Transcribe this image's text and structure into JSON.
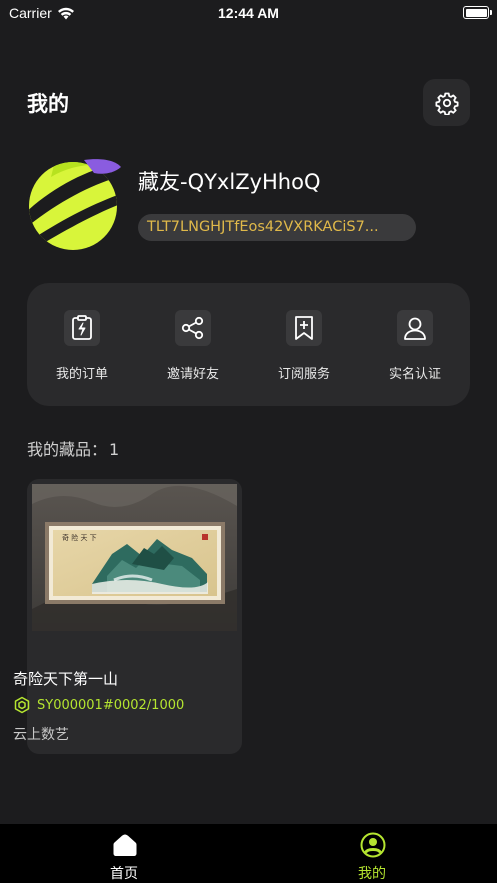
{
  "status_bar": {
    "carrier": "Carrier",
    "time": "12:44 AM"
  },
  "header": {
    "title": "我的",
    "settings_icon": "gear-icon"
  },
  "profile": {
    "avatar_icon": "planet-avatar",
    "username": "藏友-QYxlZyHhoQ",
    "address": "TLT7LNGHJTfEos42VXRKACiS7..."
  },
  "actions": [
    {
      "label": "我的订单",
      "icon": "clipboard-bolt-icon"
    },
    {
      "label": "邀请好友",
      "icon": "share-icon"
    },
    {
      "label": "订阅服务",
      "icon": "bookmark-plus-icon"
    },
    {
      "label": "实名认证",
      "icon": "user-icon"
    }
  ],
  "collection": {
    "label": "我的藏品：",
    "count": "1",
    "items": [
      {
        "title": "奇险天下第一山",
        "serial": "SY000001#0002/1000",
        "publisher": "云上数艺"
      }
    ]
  },
  "tab_bar": {
    "tabs": [
      {
        "label": "首页",
        "icon": "home-icon",
        "active": false
      },
      {
        "label": "我的",
        "icon": "profile-circle-icon",
        "active": true
      }
    ]
  },
  "colors": {
    "background": "#1c1c1e",
    "card": "#2a2a2c",
    "accent": "#b5e530",
    "address": "#e0b94a",
    "tab_bar": "#000000"
  }
}
